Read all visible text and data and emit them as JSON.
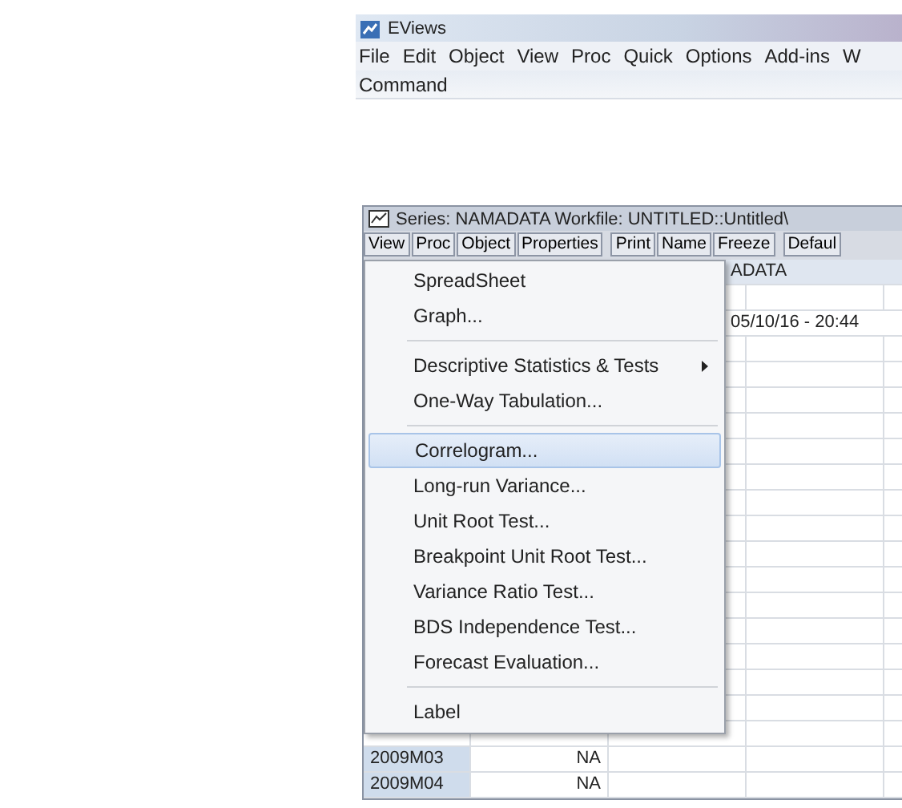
{
  "app": {
    "title": "EViews"
  },
  "menu_bar": [
    "File",
    "Edit",
    "Object",
    "View",
    "Proc",
    "Quick",
    "Options",
    "Add-ins",
    "W"
  ],
  "command_label": "Command",
  "series_window": {
    "title": "Series: NAMADATA   Workfile: UNTITLED::Untitled\\",
    "toolbar_groups": [
      [
        "View",
        "Proc",
        "Object",
        "Properties"
      ],
      [
        "Print",
        "Name",
        "Freeze"
      ],
      [
        "Defaul"
      ]
    ],
    "grid": {
      "header": "ADATA",
      "updated": "05/10/16 - 20:44",
      "rows": [
        {
          "label": "2009M03",
          "value": "NA"
        },
        {
          "label": "2009M04",
          "value": "NA"
        }
      ]
    }
  },
  "view_menu": {
    "groups": [
      [
        {
          "label": "SpreadSheet",
          "kind": "item",
          "selected": false
        },
        {
          "label": "Graph...",
          "kind": "item",
          "selected": false
        }
      ],
      [
        {
          "label": "Descriptive Statistics & Tests",
          "kind": "submenu",
          "selected": false
        },
        {
          "label": "One-Way Tabulation...",
          "kind": "item",
          "selected": false
        }
      ],
      [
        {
          "label": "Correlogram...",
          "kind": "item",
          "selected": true
        },
        {
          "label": "Long-run Variance...",
          "kind": "item",
          "selected": false
        },
        {
          "label": "Unit Root Test...",
          "kind": "item",
          "selected": false
        },
        {
          "label": "Breakpoint Unit Root Test...",
          "kind": "item",
          "selected": false
        },
        {
          "label": "Variance Ratio Test...",
          "kind": "item",
          "selected": false
        },
        {
          "label": "BDS Independence Test...",
          "kind": "item",
          "selected": false
        },
        {
          "label": "Forecast Evaluation...",
          "kind": "item",
          "selected": false
        }
      ],
      [
        {
          "label": "Label",
          "kind": "item",
          "selected": false
        }
      ]
    ]
  }
}
